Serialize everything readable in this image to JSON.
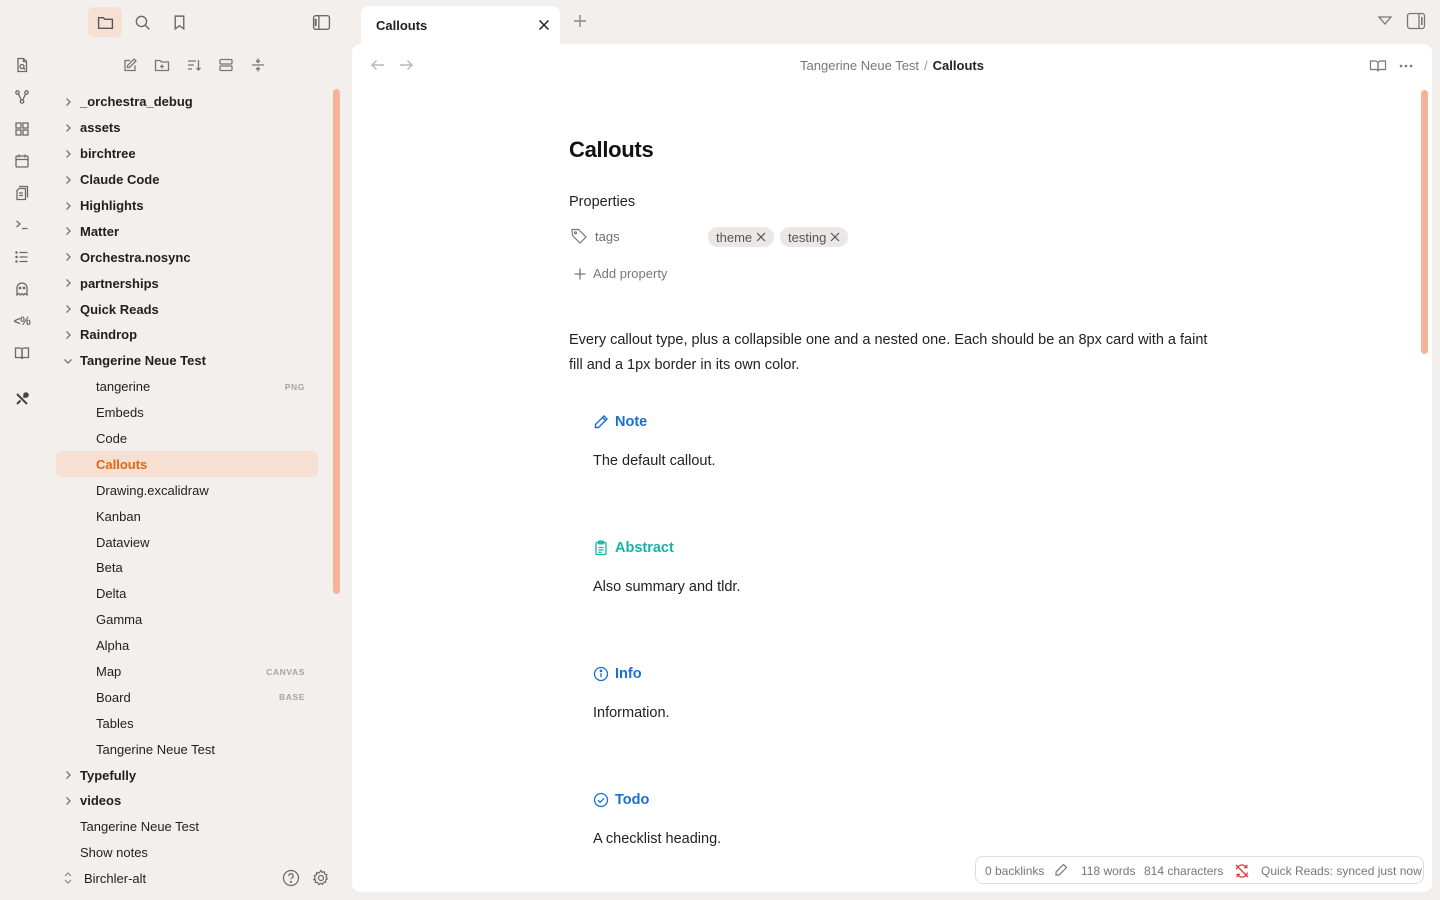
{
  "left_toolbar": {
    "icons": [
      "folder-icon",
      "search-icon",
      "bookmark-icon",
      "sidebar-toggle-icon"
    ]
  },
  "ribbon": {
    "icons": [
      "open-file-icon",
      "graph-icon",
      "canvas-icon",
      "calendar-icon",
      "templates-icon",
      "command-palette-icon",
      "outline-icon",
      "ghost-icon",
      "percent-code-icon",
      "book-icon",
      "tools-icon"
    ]
  },
  "nav_actions": [
    "new-note-icon",
    "new-folder-icon",
    "sort-icon",
    "collapse-icon",
    "auto-reveal-icon"
  ],
  "tree": [
    {
      "type": "folder",
      "label": "_orchestra_debug"
    },
    {
      "type": "folder",
      "label": "assets"
    },
    {
      "type": "folder",
      "label": "birchtree"
    },
    {
      "type": "folder",
      "label": "Claude Code"
    },
    {
      "type": "folder",
      "label": "Highlights"
    },
    {
      "type": "folder",
      "label": "Matter"
    },
    {
      "type": "folder",
      "label": "Orchestra.nosync"
    },
    {
      "type": "folder",
      "label": "partnerships"
    },
    {
      "type": "folder",
      "label": "Quick Reads"
    },
    {
      "type": "folder",
      "label": "Raindrop"
    },
    {
      "type": "folder-open",
      "label": "Tangerine Neue Test"
    },
    {
      "type": "file",
      "label": "tangerine",
      "badge": "PNG"
    },
    {
      "type": "file",
      "label": "Embeds"
    },
    {
      "type": "file",
      "label": "Code"
    },
    {
      "type": "file",
      "label": "Callouts",
      "active": true
    },
    {
      "type": "file",
      "label": "Drawing.excalidraw"
    },
    {
      "type": "file",
      "label": "Kanban"
    },
    {
      "type": "file",
      "label": "Dataview"
    },
    {
      "type": "file",
      "label": "Beta"
    },
    {
      "type": "file",
      "label": "Delta"
    },
    {
      "type": "file",
      "label": "Gamma"
    },
    {
      "type": "file",
      "label": "Alpha"
    },
    {
      "type": "file",
      "label": "Map",
      "badge": "CANVAS"
    },
    {
      "type": "file",
      "label": "Board",
      "badge": "BASE"
    },
    {
      "type": "file",
      "label": "Tables"
    },
    {
      "type": "file",
      "label": "Tangerine Neue Test"
    },
    {
      "type": "folder",
      "label": "Typefully"
    },
    {
      "type": "folder",
      "label": "videos"
    },
    {
      "type": "root",
      "label": "Tangerine Neue Test"
    },
    {
      "type": "root",
      "label": "Show notes"
    }
  ],
  "vault": {
    "name": "Birchler-alt"
  },
  "tab": {
    "title": "Callouts"
  },
  "breadcrumb": {
    "parent": "Tangerine Neue Test",
    "separator": "/",
    "current": "Callouts"
  },
  "doc": {
    "title": "Callouts",
    "properties_heading": "Properties",
    "property_key": "tags",
    "tags": [
      "theme",
      "testing"
    ],
    "add_property": "Add property",
    "intro": "Every callout type, plus a collapsible one and a nested one. Each should be an 8px card with a faint fill and a 1px border in its own color.",
    "callouts": [
      {
        "title": "Note",
        "body": "The default callout.",
        "color": "#1a6fd0",
        "icon": "pencil-icon"
      },
      {
        "title": "Abstract",
        "body": "Also summary and tldr.",
        "color": "#12b5a7",
        "icon": "clipboard-icon"
      },
      {
        "title": "Info",
        "body": "Information.",
        "color": "#1a6fd0",
        "icon": "info-icon"
      },
      {
        "title": "Todo",
        "body": "A checklist heading.",
        "color": "#1a6fd0",
        "icon": "check-circle-icon"
      }
    ]
  },
  "status": {
    "backlinks": "0 backlinks",
    "words": "118 words",
    "characters": "814 characters",
    "sync": "Quick Reads: synced just now"
  },
  "colors": {
    "accent": "#e8640c",
    "active_bg": "#f6e0d4",
    "scrollbar": "#f5b497",
    "sync_error": "#e03a3a"
  }
}
